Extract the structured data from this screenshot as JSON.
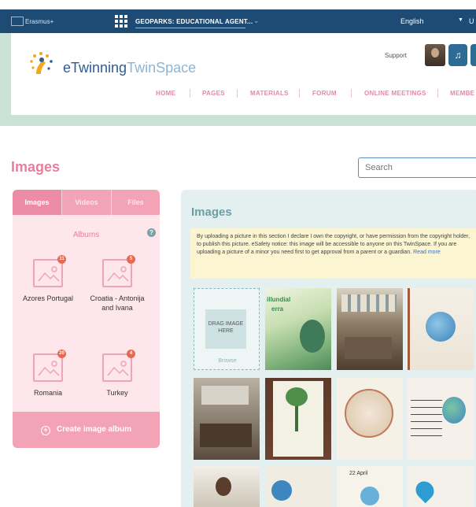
{
  "topbar": {
    "brand": "Erasmus+",
    "project": "GEOPARKS: EDUCATIONAL AGENT...",
    "language": "English",
    "user_initial": "U"
  },
  "header": {
    "logo_primary": "eTwinning",
    "logo_secondary": "TwinSpace",
    "support": "Support",
    "nav": [
      "HOME",
      "PAGES",
      "MATERIALS",
      "FORUM",
      "ONLINE MEETINGS",
      "MEMBE"
    ]
  },
  "page": {
    "title": "Images",
    "search_placeholder": "Search"
  },
  "left_panel": {
    "tabs": [
      "Images",
      "Videos",
      "Files"
    ],
    "active_tab": "Images",
    "albums_title": "Albums",
    "help": "?",
    "albums": [
      {
        "name": "Azores Portugal",
        "badge": "11"
      },
      {
        "name": "Croatia - Antonija and Ivana",
        "badge": "5"
      },
      {
        "name": "Romania",
        "badge": "20"
      },
      {
        "name": "Turkey",
        "badge": "4"
      }
    ],
    "create_button": "Create image album"
  },
  "right_panel": {
    "title": "Images",
    "notice": "By uploading a picture in this section I declare I own the copyright, or have permission from the copyright holder, to publish this picture. eSafety notice: this image will be accessible to anyone on this TwinSpace. If you are uploading a picture of a minor you need first to get approval from a parent or a guardian.",
    "read_more": "Read more",
    "dropzone_label": "DRAG IMAGE HERE",
    "browse": "Browse",
    "thumb_texts": [
      "illundial",
      "erra",
      "22 April"
    ]
  },
  "colors": {
    "topbar": "#1d4b73",
    "accent_pink": "#e57f9d",
    "panel_pink": "#fde6ec",
    "panel_teal": "#e4f0ef",
    "notice_yellow": "#fcf5d2"
  }
}
